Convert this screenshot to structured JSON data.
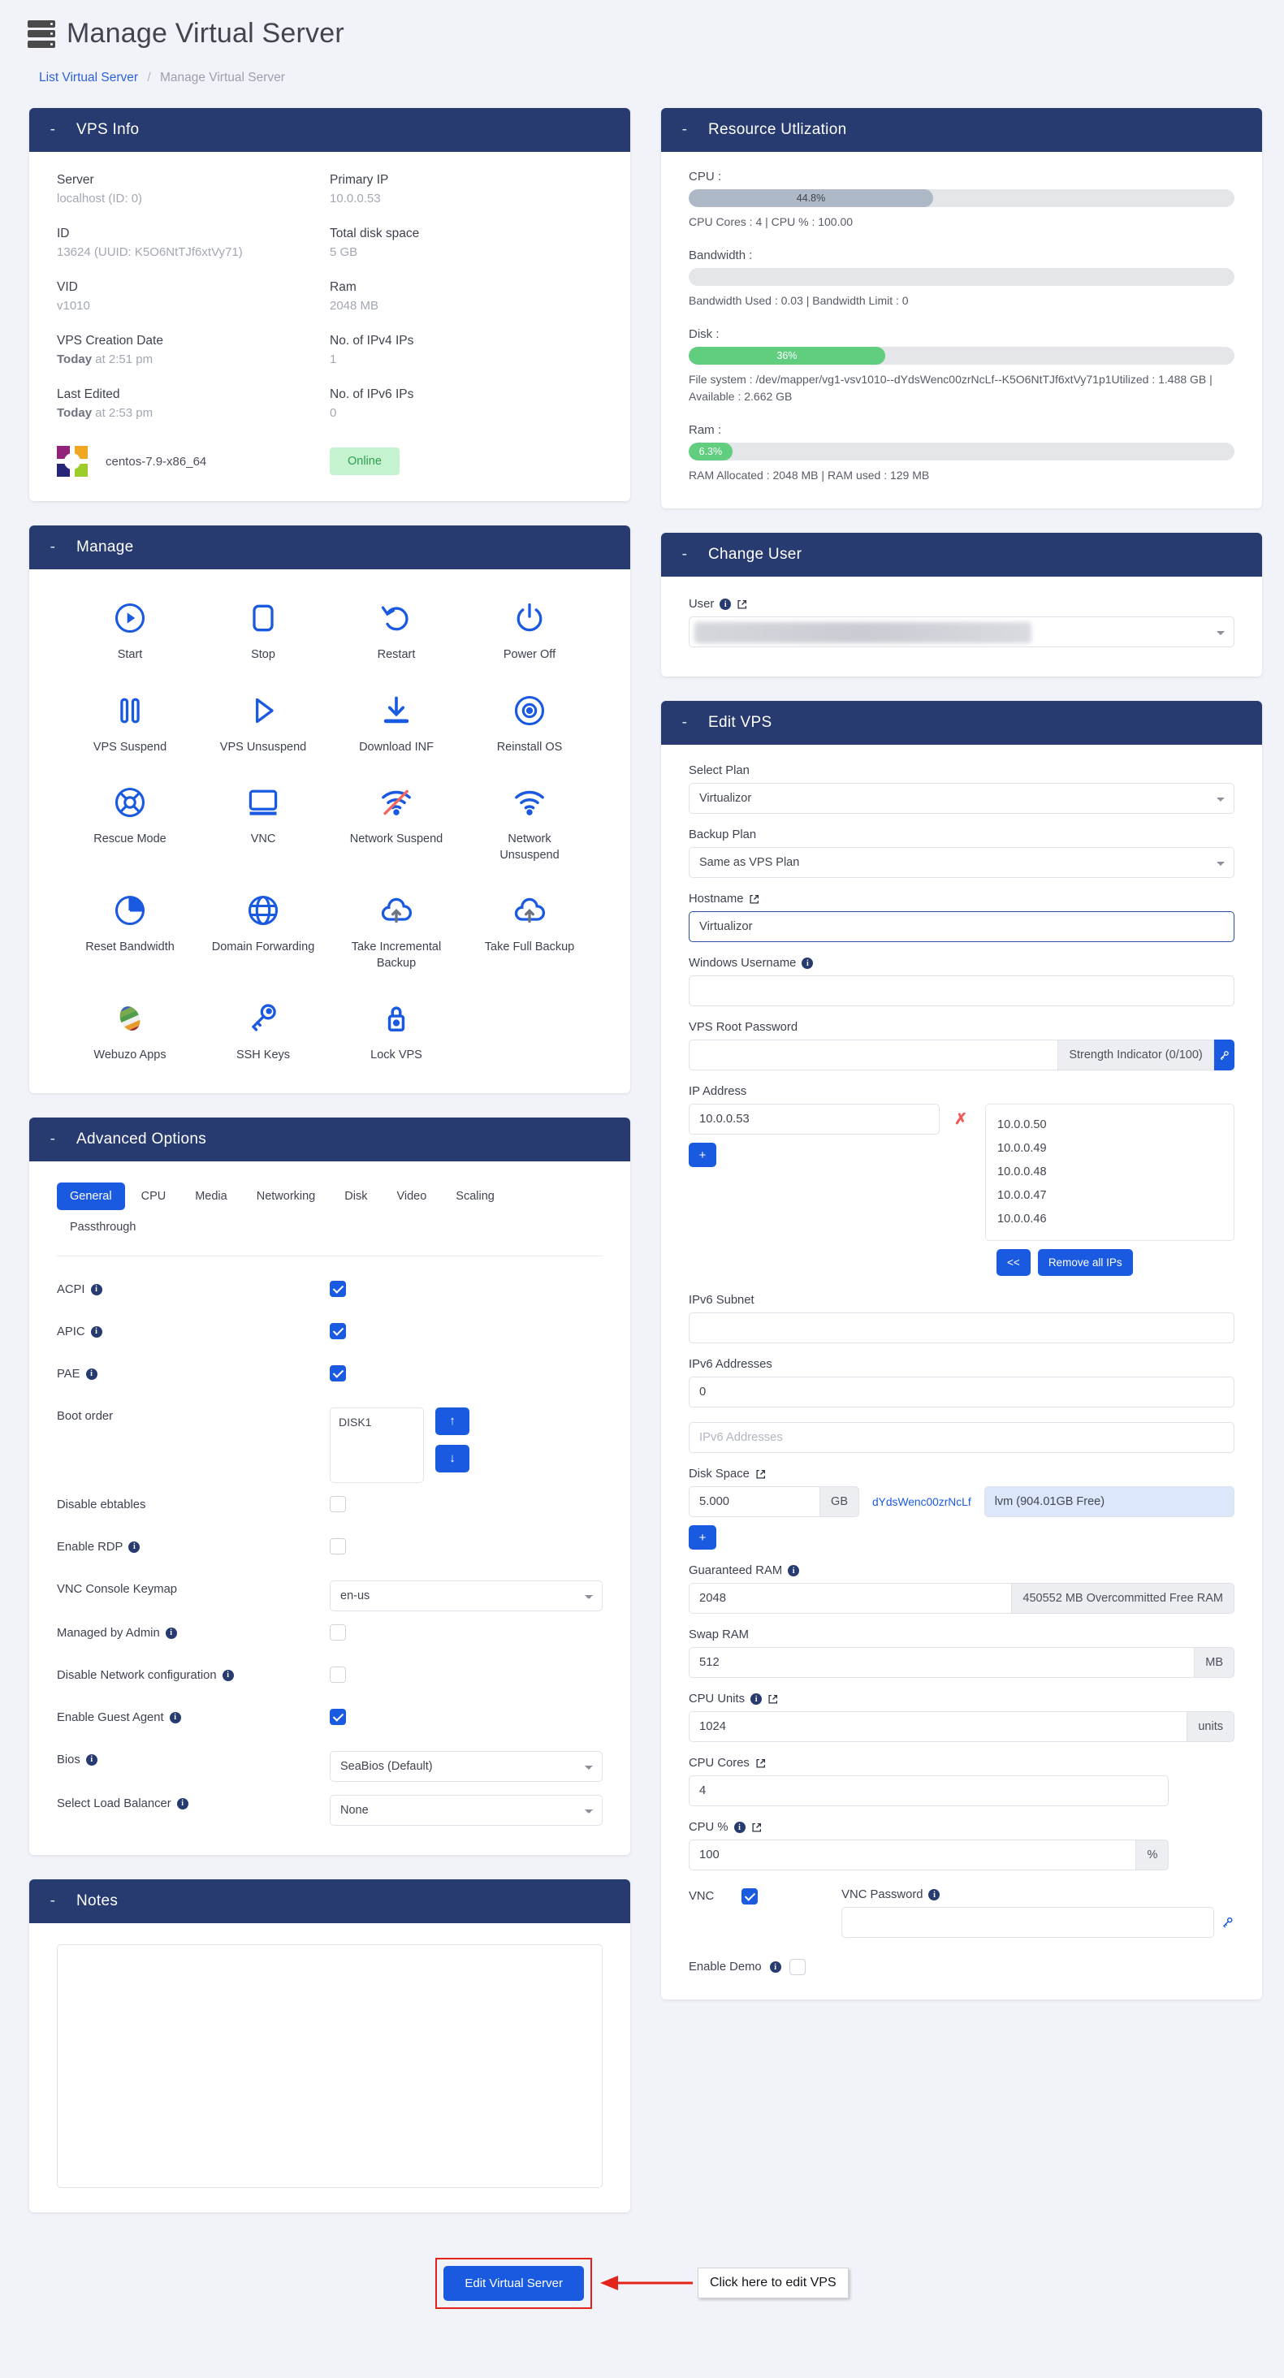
{
  "header": {
    "title": "Manage Virtual Server",
    "icon": "server-rack-icon"
  },
  "breadcrumb": {
    "link": "List Virtual Server",
    "separator": "/",
    "current": "Manage Virtual Server"
  },
  "vps_info": {
    "panel_title": "VPS Info",
    "collapse": "-",
    "fields": [
      {
        "label": "Server",
        "value": "localhost (ID: 0)"
      },
      {
        "label": "Primary IP",
        "value": "10.0.0.53"
      },
      {
        "label": "ID",
        "value": "13624 (UUID: K5O6NtTJf6xtVy71)"
      },
      {
        "label": "Total disk space",
        "value": "5 GB"
      },
      {
        "label": "VID",
        "value": "v1010"
      },
      {
        "label": "Ram",
        "value": "2048 MB"
      },
      {
        "label": "VPS Creation Date",
        "value_bold": "Today",
        "value": "at 2:51 pm"
      },
      {
        "label": "No. of IPv4 IPs",
        "value": "1"
      },
      {
        "label": "Last Edited",
        "value_bold": "Today",
        "value": "at 2:53 pm"
      },
      {
        "label": "No. of IPv6 IPs",
        "value": "0"
      }
    ],
    "os_name": "centos-7.9-x86_64",
    "status": "Online",
    "status_color": "#2f9c52"
  },
  "resource": {
    "panel_title": "Resource Utlization",
    "collapse": "-",
    "cpu": {
      "label": "CPU :",
      "percent": 44.8,
      "percent_text": "44.8%",
      "sub": "CPU Cores : 4  |  CPU % : 100.00",
      "cores": 4,
      "cpu_pct_limit": "100.00"
    },
    "bandwidth": {
      "label": "Bandwidth :",
      "percent": 0,
      "percent_text": "",
      "sub": "Bandwidth Used : 0.03  |  Bandwidth Limit : 0",
      "used": "0.03",
      "limit": "0"
    },
    "disk": {
      "label": "Disk :",
      "percent": 36,
      "percent_text": "36%",
      "sub": "File system : /dev/mapper/vg1-vsv1010--dYdsWenc00zrNcLf--K5O6NtTJf6xtVy71p1Utilized : 1.488 GB  |  Available : 2.662 GB",
      "utilized": "1.488 GB",
      "available": "2.662 GB"
    },
    "ram": {
      "label": "Ram :",
      "percent": 6.3,
      "percent_text": "6.3%",
      "sub": "RAM Allocated : 2048 MB  |  RAM used : 129 MB",
      "allocated": "2048 MB",
      "used": "129 MB"
    }
  },
  "manage": {
    "panel_title": "Manage",
    "collapse": "-",
    "actions": [
      {
        "label": "Start",
        "icon": "play-circle-icon"
      },
      {
        "label": "Stop",
        "icon": "stop-square-icon"
      },
      {
        "label": "Restart",
        "icon": "restart-arrow-icon"
      },
      {
        "label": "Power Off",
        "icon": "power-icon"
      },
      {
        "label": "VPS Suspend",
        "icon": "pause-icon"
      },
      {
        "label": "VPS Unsuspend",
        "icon": "play-triangle-icon"
      },
      {
        "label": "Download INF",
        "icon": "download-icon"
      },
      {
        "label": "Reinstall OS",
        "icon": "disc-icon"
      },
      {
        "label": "Rescue Mode",
        "icon": "lifebuoy-icon"
      },
      {
        "label": "VNC",
        "icon": "monitor-icon"
      },
      {
        "label": "Network Suspend",
        "icon": "wifi-off-icon"
      },
      {
        "label": "Network Unsuspend",
        "icon": "wifi-icon"
      },
      {
        "label": "Reset Bandwidth",
        "icon": "pie-chart-icon"
      },
      {
        "label": "Domain Forwarding",
        "icon": "globe-icon"
      },
      {
        "label": "Take Incremental Backup",
        "icon": "cloud-upload-icon"
      },
      {
        "label": "Take Full Backup",
        "icon": "cloud-upload-icon"
      },
      {
        "label": "Webuzo Apps",
        "icon": "webuzo-logo-icon"
      },
      {
        "label": "SSH Keys",
        "icon": "key-icon"
      },
      {
        "label": "Lock VPS",
        "icon": "lock-icon"
      }
    ]
  },
  "advanced": {
    "panel_title": "Advanced Options",
    "collapse": "-",
    "tabs": [
      {
        "label": "General",
        "active": true
      },
      {
        "label": "CPU",
        "active": false
      },
      {
        "label": "Media",
        "active": false
      },
      {
        "label": "Networking",
        "active": false
      },
      {
        "label": "Disk",
        "active": false
      },
      {
        "label": "Video",
        "active": false
      },
      {
        "label": "Scaling",
        "active": false
      },
      {
        "label": "Passthrough",
        "active": false
      }
    ],
    "acpi": {
      "label": "ACPI",
      "checked": true,
      "info": true
    },
    "apic": {
      "label": "APIC",
      "checked": true,
      "info": true
    },
    "pae": {
      "label": "PAE",
      "checked": true,
      "info": true
    },
    "boot_order": {
      "label": "Boot order",
      "items": "DISK1",
      "up": "↑",
      "down": "↓"
    },
    "disable_ebtables": {
      "label": "Disable ebtables",
      "checked": false,
      "info": false
    },
    "enable_rdp": {
      "label": "Enable RDP",
      "checked": false,
      "info": true
    },
    "vnc_keymap": {
      "label": "VNC Console Keymap",
      "value": "en-us"
    },
    "managed_by_admin": {
      "label": "Managed by Admin",
      "checked": false,
      "info": true
    },
    "disable_network_config": {
      "label": "Disable Network configuration",
      "checked": false,
      "info": true
    },
    "enable_guest_agent": {
      "label": "Enable Guest Agent",
      "checked": true,
      "info": true
    },
    "bios": {
      "label": "Bios",
      "value": "SeaBios (Default)"
    },
    "load_balancer": {
      "label": "Select Load Balancer",
      "value": "None"
    }
  },
  "notes": {
    "panel_title": "Notes",
    "collapse": "-",
    "value": ""
  },
  "change_user": {
    "panel_title": "Change User",
    "collapse": "-",
    "label": "User",
    "value": "",
    "redacted": true
  },
  "edit_vps": {
    "panel_title": "Edit VPS",
    "collapse": "-",
    "select_plan": {
      "label": "Select Plan",
      "value": "Virtualizor"
    },
    "backup_plan": {
      "label": "Backup Plan",
      "value": "Same as VPS Plan"
    },
    "hostname": {
      "label": "Hostname",
      "value": "Virtualizor"
    },
    "windows_username": {
      "label": "Windows Username",
      "value": ""
    },
    "root_password": {
      "label": "VPS Root Password",
      "value": "",
      "strength": "Strength Indicator (0/100)"
    },
    "ip_address": {
      "label": "IP Address",
      "primary": "10.0.0.53",
      "remove_mark": "✗",
      "add_button": "+",
      "available": [
        "10.0.0.50",
        "10.0.0.49",
        "10.0.0.48",
        "10.0.0.47",
        "10.0.0.46"
      ],
      "move_button": "<<",
      "remove_all_button": "Remove all IPs"
    },
    "ipv6_subnet": {
      "label": "IPv6 Subnet",
      "value": ""
    },
    "ipv6_addresses_count": {
      "label": "IPv6 Addresses",
      "value": "0"
    },
    "ipv6_addresses_input": {
      "placeholder": "IPv6 Addresses",
      "value": ""
    },
    "disk_space": {
      "label": "Disk Space",
      "value": "5.000",
      "unit": "GB",
      "disk_id": "dYdsWenc00zrNcLf",
      "storage": "lvm (904.01GB Free)",
      "add_button": "+"
    },
    "guaranteed_ram": {
      "label": "Guaranteed RAM",
      "value": "2048",
      "addon": "450552 MB Overcommitted Free RAM"
    },
    "swap_ram": {
      "label": "Swap RAM",
      "value": "512",
      "unit": "MB"
    },
    "cpu_units": {
      "label": "CPU Units",
      "value": "1024",
      "unit": "units"
    },
    "cpu_cores": {
      "label": "CPU Cores",
      "value": "4"
    },
    "cpu_percent": {
      "label": "CPU %",
      "value": "100",
      "unit": "%"
    },
    "vnc": {
      "label": "VNC",
      "checked": true
    },
    "vnc_password": {
      "label": "VNC Password",
      "value": ""
    },
    "enable_demo": {
      "label": "Enable Demo",
      "checked": false
    }
  },
  "footer": {
    "submit_button": "Edit Virtual Server",
    "callout": "Click here to edit VPS",
    "highlight_color": "#e4231b",
    "accent_color": "#1a5ae0"
  }
}
